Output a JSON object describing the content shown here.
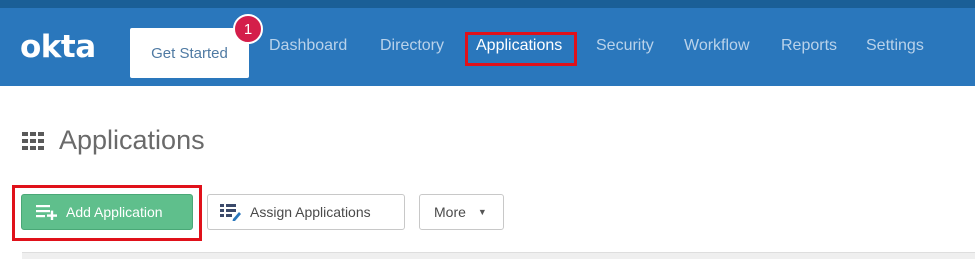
{
  "header": {
    "logo": "okta",
    "get_started": "Get Started",
    "badge_count": "1",
    "nav": [
      {
        "label": "Dashboard"
      },
      {
        "label": "Directory"
      },
      {
        "label": "Applications"
      },
      {
        "label": "Security"
      },
      {
        "label": "Workflow"
      },
      {
        "label": "Reports"
      },
      {
        "label": "Settings"
      }
    ]
  },
  "main": {
    "title": "Applications",
    "buttons": {
      "add": "Add Application",
      "assign": "Assign Applications",
      "more": "More"
    }
  },
  "colors": {
    "nav_bg": "#2a77bc",
    "add_button": "#5fbf8c",
    "highlight": "#e0111a",
    "badge": "#d41e4a"
  },
  "icons": [
    "grid-icon",
    "add-list-icon",
    "assign-icon",
    "caret-down-icon"
  ]
}
